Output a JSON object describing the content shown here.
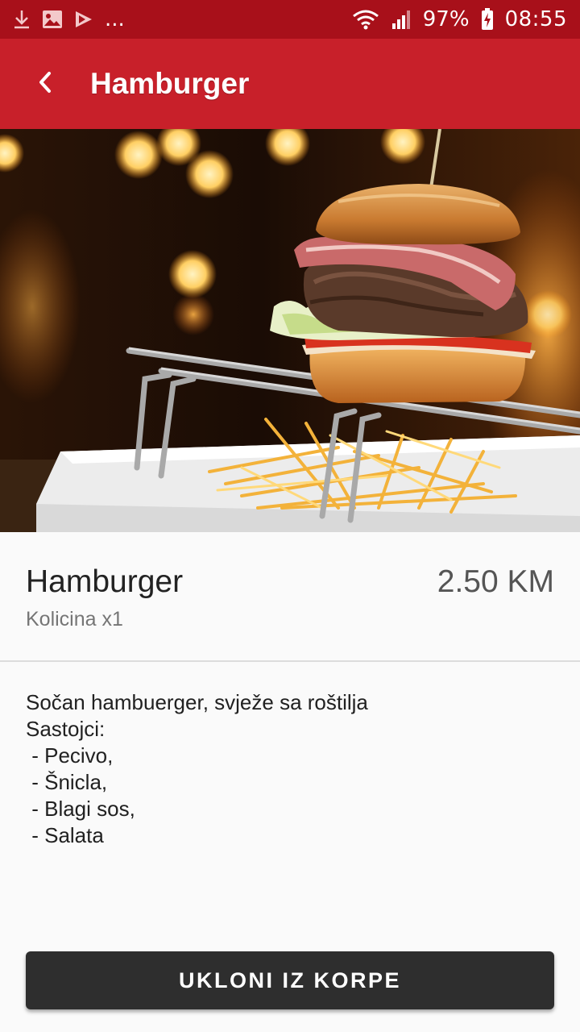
{
  "status_bar": {
    "icons": [
      "download-icon",
      "image-icon",
      "play-store-icon"
    ],
    "more": "...",
    "battery": "97%",
    "time": "08:55"
  },
  "app_bar": {
    "title": "Hamburger",
    "back_icon": "back-arrow-icon",
    "color": "#c8202a"
  },
  "product": {
    "name": "Hamburger",
    "price": "2.50 KM",
    "quantity": "Kolicina x1"
  },
  "description": {
    "lines": [
      "Sočan hambuerger, svježe sa roštilja",
      "Sastojci:",
      " - Pecivo,",
      " - Šnicla,",
      " - Blagi sos,",
      " - Salata"
    ]
  },
  "actions": {
    "remove_label": "UKLONI IZ KORPE"
  }
}
